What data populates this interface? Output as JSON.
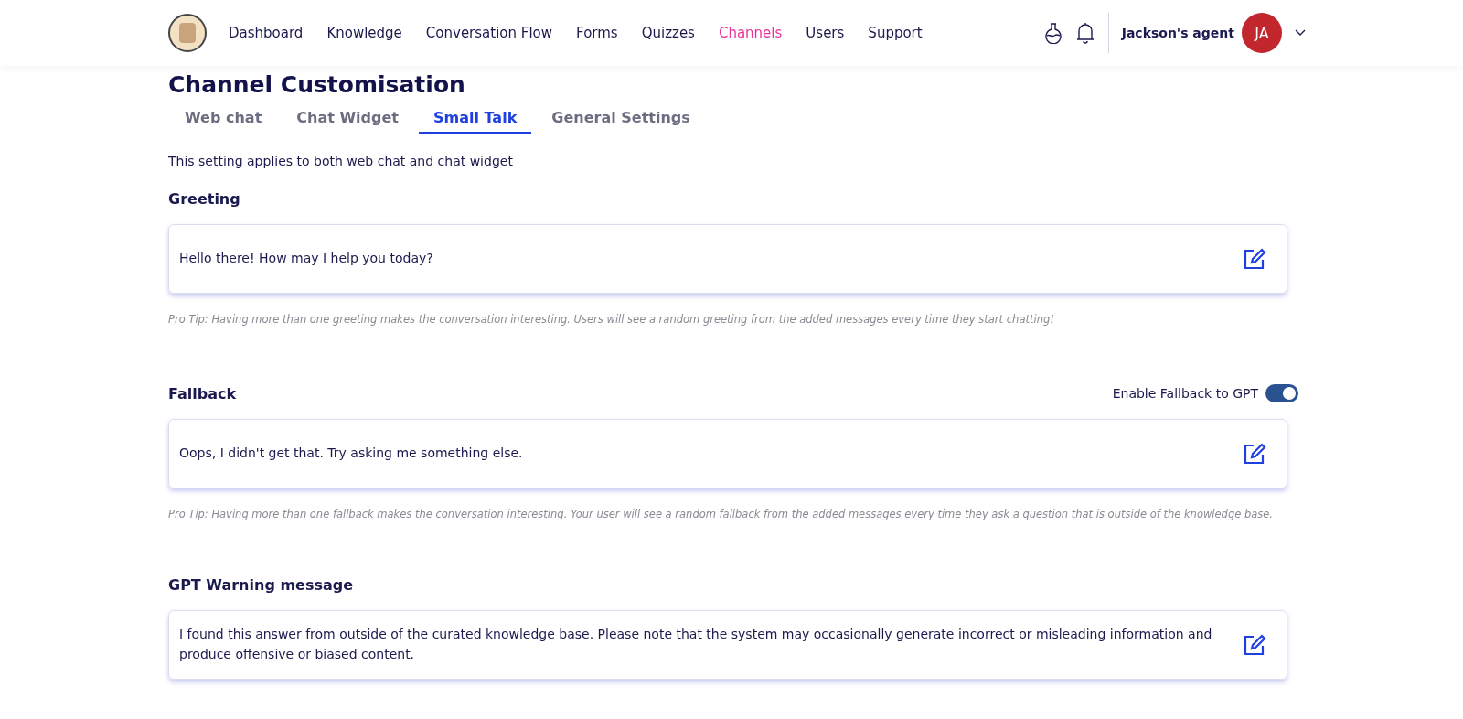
{
  "nav": {
    "items": [
      {
        "label": "Dashboard",
        "selected": false
      },
      {
        "label": "Knowledge",
        "selected": false
      },
      {
        "label": "Conversation Flow",
        "selected": false
      },
      {
        "label": "Forms",
        "selected": false
      },
      {
        "label": "Quizzes",
        "selected": false
      },
      {
        "label": "Channels",
        "selected": true
      },
      {
        "label": "Users",
        "selected": false
      },
      {
        "label": "Support",
        "selected": false
      }
    ],
    "account": {
      "name": "Jackson's agent",
      "initials": "JA"
    }
  },
  "page": {
    "title": "Channel Customisation",
    "tabs": [
      {
        "label": "Web chat",
        "selected": false
      },
      {
        "label": "Chat Widget",
        "selected": false
      },
      {
        "label": "Small Talk",
        "selected": true
      },
      {
        "label": "General Settings",
        "selected": false
      }
    ],
    "description": "This setting applies to both web chat and chat widget",
    "sections": [
      {
        "title": "Greeting",
        "message": "Hello there! How may I help you today?",
        "tip": "Pro Tip: Having more than one greeting makes the conversation interesting. Users will see a random greeting from the added messages every time they start chatting!"
      },
      {
        "title": "Fallback",
        "toggle": {
          "label": "Enable Fallback to GPT",
          "on": true
        },
        "message": "Oops, I didn't get that. Try asking me something else.",
        "tip": "Pro Tip: Having more than one fallback makes the conversation interesting. Your user will see a random fallback from the added messages every time they ask a question that is outside of the knowledge base."
      },
      {
        "title": "GPT Warning message",
        "message": "I found this answer from outside of the curated knowledge base. Please note that the system may occasionally generate incorrect or misleading information and produce offensive or biased content."
      }
    ]
  }
}
